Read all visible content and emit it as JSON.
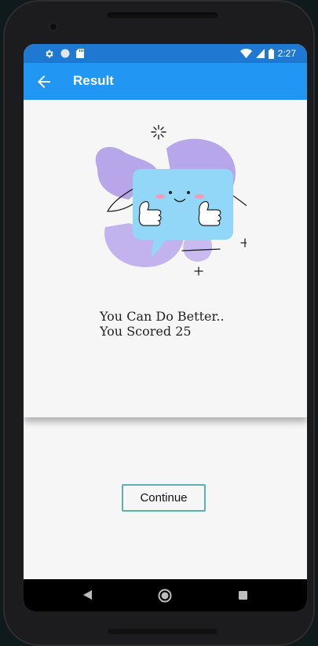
{
  "status_bar": {
    "time": "2:27",
    "icons_left": [
      "gear-icon",
      "circle-icon",
      "sd-card-icon"
    ],
    "icons_right": [
      "wifi-icon",
      "signal-icon",
      "battery-icon"
    ]
  },
  "app_bar": {
    "title": "Result",
    "back_icon": "arrow-back-icon",
    "color": "#2196f3"
  },
  "result": {
    "line1": "You Can Do Better..",
    "line2": "You Scored 25",
    "illustration": "thumbs-up-chat-bubble-illustration"
  },
  "actions": {
    "continue_label": "Continue",
    "border_color": "#5ab0b3"
  },
  "nav_bar": {
    "icons": [
      "nav-back-icon",
      "nav-home-icon",
      "nav-recent-apps-icon"
    ]
  }
}
